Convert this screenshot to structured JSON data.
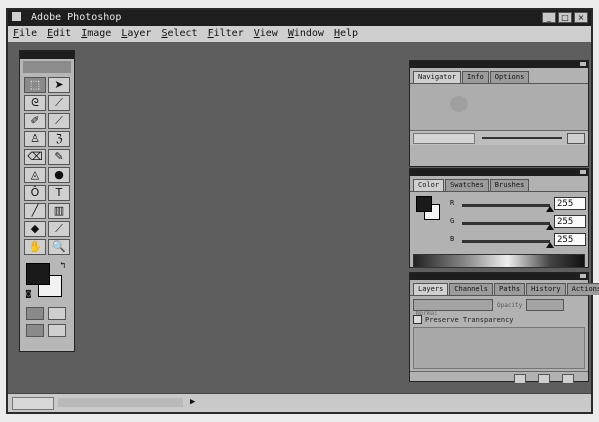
{
  "window": {
    "title": "Adobe Photoshop",
    "minimize": "_",
    "maximize": "□",
    "close": "×"
  },
  "menubar": {
    "items": [
      {
        "key": "F",
        "rest": "ile"
      },
      {
        "key": "E",
        "rest": "dit"
      },
      {
        "key": "I",
        "rest": "mage"
      },
      {
        "key": "L",
        "rest": "ayer"
      },
      {
        "key": "S",
        "rest": "elect"
      },
      {
        "key": "F",
        "rest": "ilter"
      },
      {
        "key": "V",
        "rest": "iew"
      },
      {
        "key": "W",
        "rest": "indow"
      },
      {
        "key": "H",
        "rest": "elp"
      }
    ]
  },
  "toolbox": {
    "tools": [
      {
        "name": "marquee-tool",
        "glyph": "⬚"
      },
      {
        "name": "move-tool",
        "glyph": "➤"
      },
      {
        "name": "lasso-tool",
        "glyph": "ᘓ"
      },
      {
        "name": "magic-wand-tool",
        "glyph": "⟋"
      },
      {
        "name": "airbrush-tool",
        "glyph": "✐"
      },
      {
        "name": "paintbrush-tool",
        "glyph": "⟋"
      },
      {
        "name": "rubber-stamp-tool",
        "glyph": "♙"
      },
      {
        "name": "history-brush-tool",
        "glyph": "ℨ"
      },
      {
        "name": "eraser-tool",
        "glyph": "⌫"
      },
      {
        "name": "pencil-tool",
        "glyph": "✎"
      },
      {
        "name": "blur-tool",
        "glyph": "◬"
      },
      {
        "name": "dodge-tool",
        "glyph": "●"
      },
      {
        "name": "pen-tool",
        "glyph": "Ô"
      },
      {
        "name": "type-tool",
        "glyph": "T"
      },
      {
        "name": "line-tool",
        "glyph": "╱"
      },
      {
        "name": "gradient-tool",
        "glyph": "▥"
      },
      {
        "name": "paint-bucket-tool",
        "glyph": "◆"
      },
      {
        "name": "eyedropper-tool",
        "glyph": "⟋"
      },
      {
        "name": "hand-tool",
        "glyph": "✋"
      },
      {
        "name": "zoom-tool",
        "glyph": "🔍"
      }
    ],
    "selected_tool": "marquee-tool",
    "swap_glyph": "↰",
    "default_glyph": "◙"
  },
  "navigator": {
    "tabs": [
      "Navigator",
      "Info",
      "Options"
    ]
  },
  "color": {
    "tabs": [
      "Color",
      "Swatches",
      "Brushes"
    ],
    "channels": [
      {
        "letter": "R",
        "value": "255",
        "level": 1.0
      },
      {
        "letter": "G",
        "value": "255",
        "level": 1.0
      },
      {
        "letter": "B",
        "value": "255",
        "level": 1.0
      }
    ]
  },
  "layers": {
    "tabs": [
      "Layers",
      "Channels",
      "Paths",
      "History",
      "Actions"
    ],
    "blend_mode": "Normal",
    "opacity_label": "Opacity",
    "preserve_label": "Preserve Transparency"
  }
}
